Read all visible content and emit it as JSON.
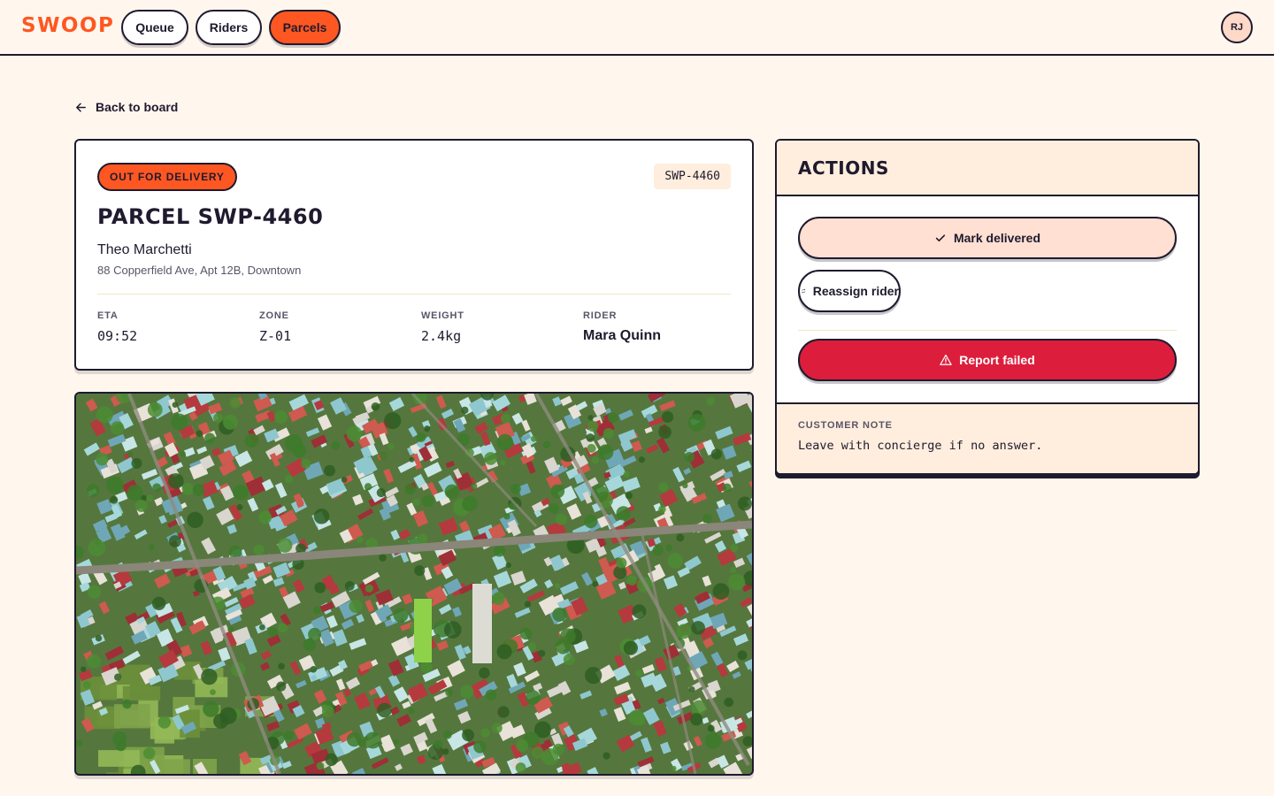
{
  "brand": {
    "logo": "SWOOP",
    "accent": "#ff5722"
  },
  "nav": {
    "tabs": [
      {
        "label": "Queue",
        "active": false
      },
      {
        "label": "Riders",
        "active": false
      },
      {
        "label": "Parcels",
        "active": true
      }
    ]
  },
  "user": {
    "initials": "RJ"
  },
  "back": {
    "label": "Back to board",
    "icon": "arrow-left-icon"
  },
  "parcel": {
    "status": "OUT FOR DELIVERY",
    "code": "SWP-4460",
    "title": "PARCEL SWP-4460",
    "recipient": "Theo Marchetti",
    "address": "88 Copperfield Ave, Apt 12B, Downtown",
    "meta": {
      "eta_label": "ETA",
      "eta": "09:52",
      "zone_label": "ZONE",
      "zone": "Z-01",
      "weight_label": "WEIGHT",
      "weight": "2.4kg",
      "rider_label": "RIDER",
      "rider": "Mara Quinn"
    }
  },
  "actions": {
    "title": "ACTIONS",
    "mark_delivered": "Mark delivered",
    "reassign_rider": "Reassign rider",
    "report_failed": "Report failed",
    "danger_color": "#dc1e3c",
    "note_label": "CUSTOMER NOTE",
    "note_text": "Leave with concierge if no answer."
  }
}
